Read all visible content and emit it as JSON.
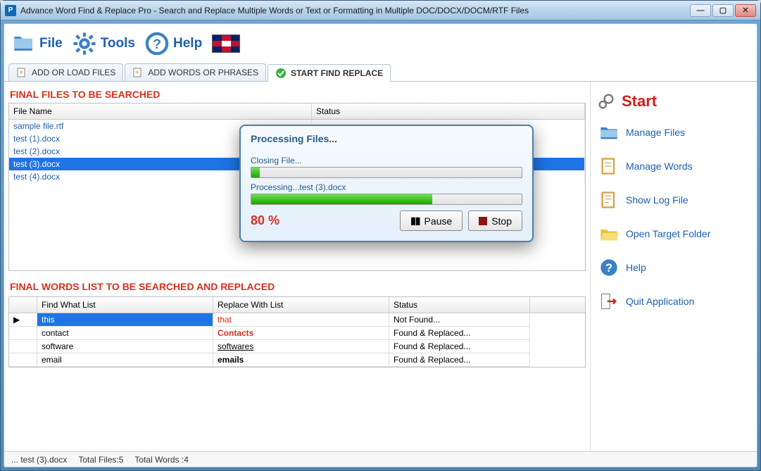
{
  "window": {
    "title": "Advance Word Find & Replace Pro - Search and Replace Multiple Words or Text  or Formatting in Multiple DOC/DOCX/DOCM/RTF Files"
  },
  "toolbar": {
    "file": "File",
    "tools": "Tools",
    "help": "Help"
  },
  "tabs": {
    "add_files": "ADD OR LOAD FILES",
    "add_words": "ADD WORDS OR PHRASES",
    "start": "START FIND REPLACE"
  },
  "files_section": {
    "title": "FINAL FILES TO BE SEARCHED",
    "col_file": "File Name",
    "col_status": "Status",
    "rows": [
      {
        "name": "sample file.rtf"
      },
      {
        "name": "test (1).docx"
      },
      {
        "name": "test (2).docx"
      },
      {
        "name": "test (3).docx",
        "selected": true
      },
      {
        "name": "test (4).docx"
      }
    ]
  },
  "words_section": {
    "title": "FINAL WORDS LIST TO BE SEARCHED AND REPLACED",
    "col_mark": "",
    "col_find": "Find What List",
    "col_repl": "Replace With List",
    "col_stat": "Status",
    "rows": [
      {
        "find": "this",
        "repl": "that",
        "stat": "Not Found...",
        "selected": true,
        "repl_style": "red"
      },
      {
        "find": "contact",
        "repl": "Contacts",
        "stat": "Found & Replaced...",
        "repl_style": "red bold"
      },
      {
        "find": "software",
        "repl": "softwares",
        "stat": "Found & Replaced...",
        "repl_style": "underline"
      },
      {
        "find": "email",
        "repl": "emails",
        "stat": "Found & Replaced...",
        "repl_style": "bold"
      }
    ]
  },
  "sidebar": {
    "start": "Start",
    "manage_files": "Manage Files",
    "manage_words": "Manage Words",
    "show_log": "Show Log File",
    "open_target": "Open Target Folder",
    "help": "Help",
    "quit": "Quit Application"
  },
  "dialog": {
    "title": "Processing Files...",
    "sub1": "Closing File...",
    "bar1_pct": 3,
    "sub2": "Processing...test (3).docx",
    "bar2_pct": 67,
    "percent": "80 %",
    "pause": "Pause",
    "stop": "Stop"
  },
  "statusbar": {
    "current": "... test (3).docx",
    "total_files": "Total Files:5",
    "total_words": "Total Words :4"
  }
}
